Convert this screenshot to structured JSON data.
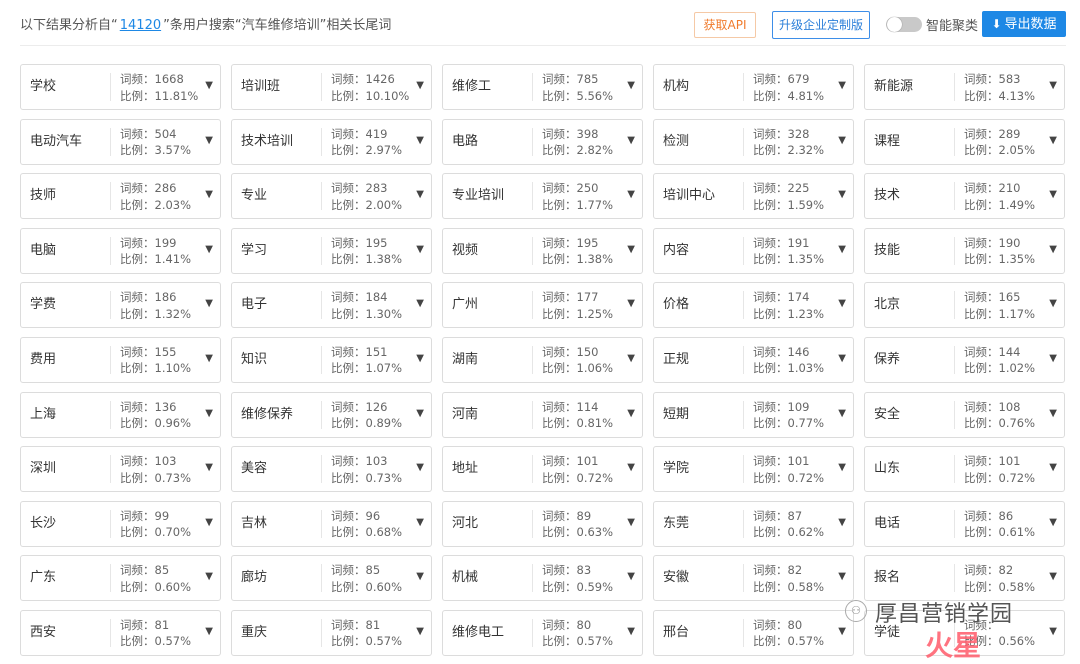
{
  "header": {
    "intro_prefix": "以下结果分析自“",
    "record_count": "14120",
    "intro_suffix": "”条用户搜索“汽车维修培训”相关长尾词",
    "api_button": "获取API",
    "upgrade_button": "升级企业定制版",
    "toggle_label": "智能聚类",
    "toggle_on": false,
    "export_button": "导出数据",
    "colors": {
      "primary": "#1e88e5",
      "api_orange": "#f07b2c"
    }
  },
  "freq_label": "词频：",
  "ratio_label": "比例：",
  "cards": [
    {
      "kw": "学校",
      "freq": "1668",
      "ratio": "11.81%"
    },
    {
      "kw": "培训班",
      "freq": "1426",
      "ratio": "10.10%"
    },
    {
      "kw": "维修工",
      "freq": "785",
      "ratio": "5.56%"
    },
    {
      "kw": "机构",
      "freq": "679",
      "ratio": "4.81%"
    },
    {
      "kw": "新能源",
      "freq": "583",
      "ratio": "4.13%"
    },
    {
      "kw": "电动汽车",
      "freq": "504",
      "ratio": "3.57%"
    },
    {
      "kw": "技术培训",
      "freq": "419",
      "ratio": "2.97%"
    },
    {
      "kw": "电路",
      "freq": "398",
      "ratio": "2.82%"
    },
    {
      "kw": "检测",
      "freq": "328",
      "ratio": "2.32%"
    },
    {
      "kw": "课程",
      "freq": "289",
      "ratio": "2.05%"
    },
    {
      "kw": "技师",
      "freq": "286",
      "ratio": "2.03%"
    },
    {
      "kw": "专业",
      "freq": "283",
      "ratio": "2.00%"
    },
    {
      "kw": "专业培训",
      "freq": "250",
      "ratio": "1.77%"
    },
    {
      "kw": "培训中心",
      "freq": "225",
      "ratio": "1.59%"
    },
    {
      "kw": "技术",
      "freq": "210",
      "ratio": "1.49%"
    },
    {
      "kw": "电脑",
      "freq": "199",
      "ratio": "1.41%"
    },
    {
      "kw": "学习",
      "freq": "195",
      "ratio": "1.38%"
    },
    {
      "kw": "视频",
      "freq": "195",
      "ratio": "1.38%"
    },
    {
      "kw": "内容",
      "freq": "191",
      "ratio": "1.35%"
    },
    {
      "kw": "技能",
      "freq": "190",
      "ratio": "1.35%"
    },
    {
      "kw": "学费",
      "freq": "186",
      "ratio": "1.32%"
    },
    {
      "kw": "电子",
      "freq": "184",
      "ratio": "1.30%"
    },
    {
      "kw": "广州",
      "freq": "177",
      "ratio": "1.25%"
    },
    {
      "kw": "价格",
      "freq": "174",
      "ratio": "1.23%"
    },
    {
      "kw": "北京",
      "freq": "165",
      "ratio": "1.17%"
    },
    {
      "kw": "费用",
      "freq": "155",
      "ratio": "1.10%"
    },
    {
      "kw": "知识",
      "freq": "151",
      "ratio": "1.07%"
    },
    {
      "kw": "湖南",
      "freq": "150",
      "ratio": "1.06%"
    },
    {
      "kw": "正规",
      "freq": "146",
      "ratio": "1.03%"
    },
    {
      "kw": "保养",
      "freq": "144",
      "ratio": "1.02%"
    },
    {
      "kw": "上海",
      "freq": "136",
      "ratio": "0.96%"
    },
    {
      "kw": "维修保养",
      "freq": "126",
      "ratio": "0.89%"
    },
    {
      "kw": "河南",
      "freq": "114",
      "ratio": "0.81%"
    },
    {
      "kw": "短期",
      "freq": "109",
      "ratio": "0.77%"
    },
    {
      "kw": "安全",
      "freq": "108",
      "ratio": "0.76%"
    },
    {
      "kw": "深圳",
      "freq": "103",
      "ratio": "0.73%"
    },
    {
      "kw": "美容",
      "freq": "103",
      "ratio": "0.73%"
    },
    {
      "kw": "地址",
      "freq": "101",
      "ratio": "0.72%"
    },
    {
      "kw": "学院",
      "freq": "101",
      "ratio": "0.72%"
    },
    {
      "kw": "山东",
      "freq": "101",
      "ratio": "0.72%"
    },
    {
      "kw": "长沙",
      "freq": "99",
      "ratio": "0.70%"
    },
    {
      "kw": "吉林",
      "freq": "96",
      "ratio": "0.68%"
    },
    {
      "kw": "河北",
      "freq": "89",
      "ratio": "0.63%"
    },
    {
      "kw": "东莞",
      "freq": "87",
      "ratio": "0.62%"
    },
    {
      "kw": "电话",
      "freq": "86",
      "ratio": "0.61%"
    },
    {
      "kw": "广东",
      "freq": "85",
      "ratio": "0.60%"
    },
    {
      "kw": "廊坊",
      "freq": "85",
      "ratio": "0.60%"
    },
    {
      "kw": "机械",
      "freq": "83",
      "ratio": "0.59%"
    },
    {
      "kw": "安徽",
      "freq": "82",
      "ratio": "0.58%"
    },
    {
      "kw": "报名",
      "freq": "82",
      "ratio": "0.58%"
    },
    {
      "kw": "西安",
      "freq": "81",
      "ratio": "0.57%"
    },
    {
      "kw": "重庆",
      "freq": "81",
      "ratio": "0.57%"
    },
    {
      "kw": "维修电工",
      "freq": "80",
      "ratio": "0.57%"
    },
    {
      "kw": "邢台",
      "freq": "80",
      "ratio": "0.57%"
    },
    {
      "kw": "学徒",
      "freq": "",
      "ratio": "0.56%"
    }
  ],
  "watermark": {
    "title": "厚昌营销学园",
    "brand": "火星"
  }
}
